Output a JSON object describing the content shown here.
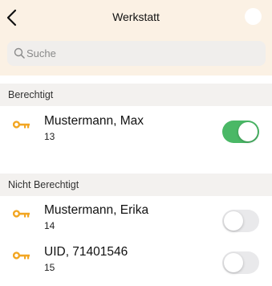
{
  "header": {
    "title": "Werkstatt",
    "back_icon": "chevron-left-icon"
  },
  "search": {
    "placeholder": "Suche",
    "value": ""
  },
  "sections": [
    {
      "title": "Berechtigt",
      "items": [
        {
          "name": "Mustermann, Max",
          "subtitle": "13",
          "icon": "key-icon",
          "enabled": true
        }
      ]
    },
    {
      "title": "Nicht Berechtigt",
      "items": [
        {
          "name": "Mustermann, Erika",
          "subtitle": "14",
          "icon": "key-icon",
          "enabled": false
        },
        {
          "name": "UID, 71401546",
          "subtitle": "15",
          "icon": "key-icon",
          "enabled": false
        }
      ]
    }
  ],
  "colors": {
    "header_bg": "#fbf1e4",
    "section_bg": "#f3f1ef",
    "key_icon": "#f2a623",
    "toggle_on": "#4ab866",
    "toggle_off": "#e9e9eb"
  }
}
